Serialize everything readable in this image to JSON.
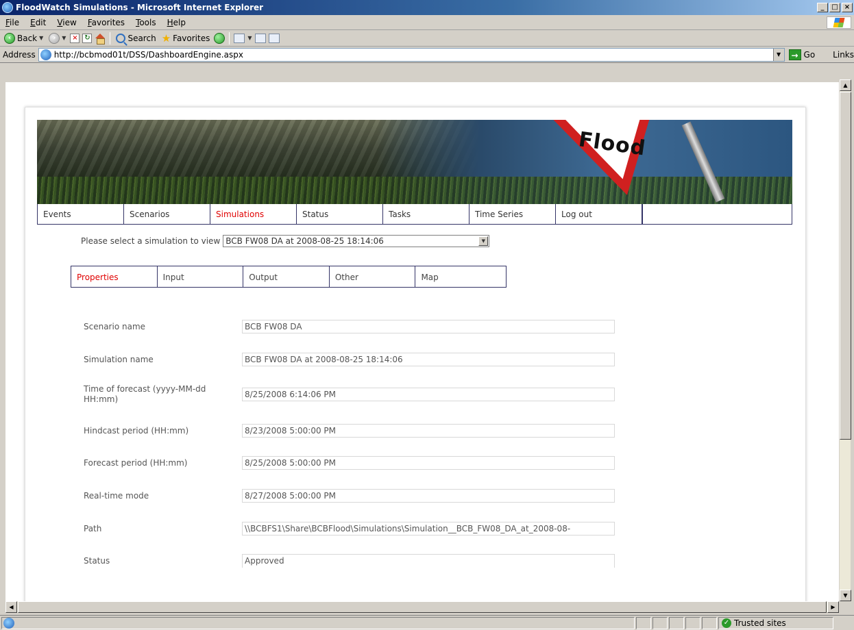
{
  "window": {
    "title": "FloodWatch Simulations - Microsoft Internet Explorer",
    "buttons": [
      "_",
      "□",
      "×"
    ]
  },
  "menu": [
    "File",
    "Edit",
    "View",
    "Favorites",
    "Tools",
    "Help"
  ],
  "toolbar": {
    "back_label": "Back",
    "search_label": "Search",
    "favorites_label": "Favorites"
  },
  "address": {
    "label": "Address",
    "url": "http://bcbmod01t/DSS/DashboardEngine.aspx",
    "go_label": "Go",
    "links_label": "Links"
  },
  "banner": {
    "sign_text": "Flood"
  },
  "main_nav": [
    {
      "label": "Events",
      "active": false
    },
    {
      "label": "Scenarios",
      "active": false
    },
    {
      "label": "Simulations",
      "active": true
    },
    {
      "label": "Status",
      "active": false
    },
    {
      "label": "Tasks",
      "active": false
    },
    {
      "label": "Time Series",
      "active": false
    },
    {
      "label": "Log out",
      "active": false
    }
  ],
  "simulation_select": {
    "label": "Please select a simulation to view",
    "selected": "BCB FW08 DA at 2008-08-25 18:14:06"
  },
  "sub_tabs": [
    {
      "label": "Properties",
      "active": true
    },
    {
      "label": "Input",
      "active": false
    },
    {
      "label": "Output",
      "active": false
    },
    {
      "label": "Other",
      "active": false
    },
    {
      "label": "Map",
      "active": false
    }
  ],
  "properties": [
    {
      "label": "Scenario name",
      "value": "BCB FW08 DA"
    },
    {
      "label": "Simulation name",
      "value": "BCB FW08 DA at 2008-08-25 18:14:06"
    },
    {
      "label": "Time of forecast (yyyy-MM-dd HH:mm)",
      "value": "8/25/2008 6:14:06 PM"
    },
    {
      "label": "Hindcast period (HH:mm)",
      "value": "8/23/2008 5:00:00 PM"
    },
    {
      "label": "Forecast period (HH:mm)",
      "value": "8/25/2008 5:00:00 PM"
    },
    {
      "label": "Real-time mode",
      "value": "8/27/2008 5:00:00 PM"
    },
    {
      "label": "Path",
      "value": "\\\\BCBFS1\\Share\\BCBFlood\\Simulations\\Simulation__BCB_FW08_DA_at_2008-08-"
    },
    {
      "label": "Status",
      "value": "Approved"
    }
  ],
  "statusbar": {
    "zone": "Trusted sites"
  }
}
